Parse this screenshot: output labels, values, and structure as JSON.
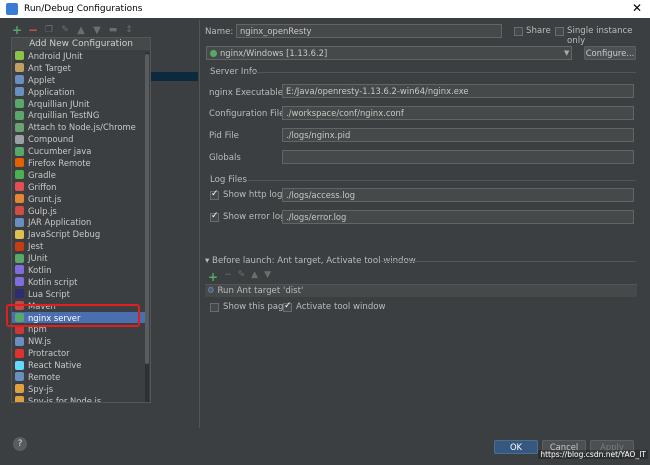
{
  "window": {
    "title": "Run/Debug Configurations"
  },
  "toolbar": {
    "icons": [
      "add-icon",
      "remove-icon",
      "copy-icon",
      "settings-icon",
      "move-up-icon",
      "move-down-icon",
      "folder-icon",
      "sort-icon"
    ]
  },
  "popup": {
    "header": "Add New Configuration",
    "items": [
      {
        "label": "Android JUnit",
        "color": "#8bc34a"
      },
      {
        "label": "Ant Target",
        "color": "#c0a060"
      },
      {
        "label": "Applet",
        "color": "#6a8ebf"
      },
      {
        "label": "Application",
        "color": "#6a8ebf"
      },
      {
        "label": "Arquillian JUnit",
        "color": "#59a869"
      },
      {
        "label": "Arquillian TestNG",
        "color": "#59a869"
      },
      {
        "label": "Attach to Node.js/Chrome",
        "color": "#6aa36f"
      },
      {
        "label": "Compound",
        "color": "#9aa0a6"
      },
      {
        "label": "Cucumber java",
        "color": "#59a869"
      },
      {
        "label": "Firefox Remote",
        "color": "#e66000"
      },
      {
        "label": "Gradle",
        "color": "#4caf50"
      },
      {
        "label": "Griffon",
        "color": "#e05050"
      },
      {
        "label": "Grunt.js",
        "color": "#e48632"
      },
      {
        "label": "Gulp.js",
        "color": "#d34a47"
      },
      {
        "label": "JAR Application",
        "color": "#6a8ebf"
      },
      {
        "label": "JavaScript Debug",
        "color": "#e0c050"
      },
      {
        "label": "Jest",
        "color": "#c63d14"
      },
      {
        "label": "JUnit",
        "color": "#59a869"
      },
      {
        "label": "Kotlin",
        "color": "#7f6cdf"
      },
      {
        "label": "Kotlin script",
        "color": "#7f6cdf"
      },
      {
        "label": "Lua Script",
        "color": "#2c2d72"
      },
      {
        "label": "Maven",
        "color": "#c44a4a"
      },
      {
        "label": "nginx server",
        "color": "#59a869"
      },
      {
        "label": "npm",
        "color": "#cb3837"
      },
      {
        "label": "NW.js",
        "color": "#6a8ebf"
      },
      {
        "label": "Protractor",
        "color": "#e03030"
      },
      {
        "label": "React Native",
        "color": "#61dafb"
      },
      {
        "label": "Remote",
        "color": "#6a8ebf"
      },
      {
        "label": "Spy-js",
        "color": "#e0a040"
      },
      {
        "label": "Spy-js for Node.js",
        "color": "#e0a040"
      }
    ],
    "selected_label": "nginx server"
  },
  "form": {
    "name_label": "Name:",
    "name_value": "nginx_openResty",
    "share_label": "Share",
    "single_instance_label": "Single instance only",
    "interpreter_value": "nginx/Windows [1.13.6.2]",
    "configure_button": "Configure...",
    "server_info_label": "Server Info",
    "nginx_exec_label": "nginx Executable",
    "nginx_exec_value": "E:/Java/openresty-1.13.6.2-win64/nginx.exe",
    "config_file_label": "Configuration File",
    "config_file_value": "./workspace/conf/nginx.conf",
    "pid_file_label": "Pid File",
    "pid_file_value": "./logs/nginx.pid",
    "globals_label": "Globals",
    "globals_value": "",
    "log_files_label": "Log Files",
    "http_log_label": "Show http log",
    "http_log_value": "./logs/access.log",
    "error_log_label": "Show error log",
    "error_log_value": "./logs/error.log",
    "before_launch_label": "Before launch: Ant target, Activate tool window",
    "before_launch_item": "Run Ant target 'dist'",
    "show_this_page_label": "Show this page",
    "activate_tool_window_label": "Activate tool window"
  },
  "buttons": {
    "ok": "OK",
    "cancel": "Cancel",
    "apply": "Apply",
    "help": "?"
  },
  "watermark": "https://blog.csdn.net/YAO_IT"
}
